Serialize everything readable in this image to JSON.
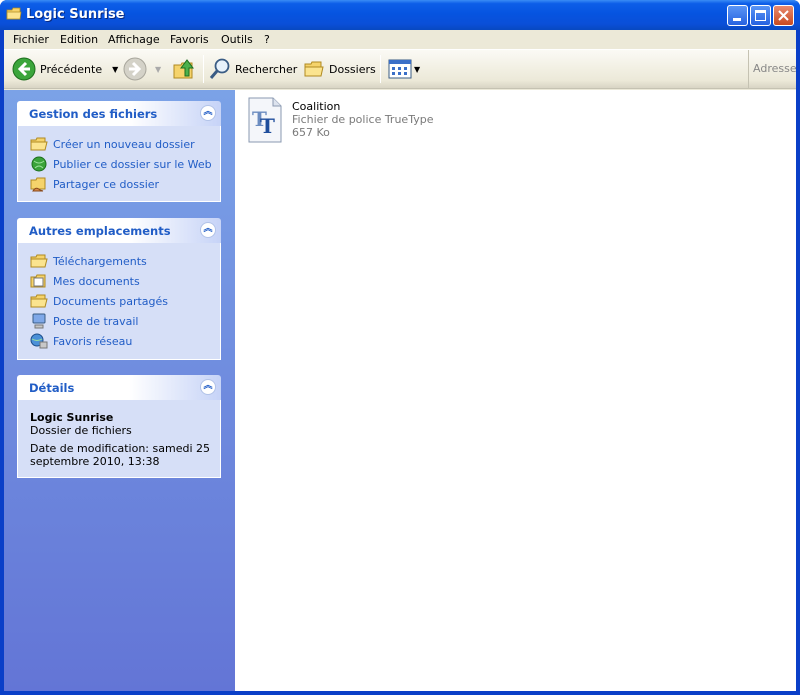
{
  "window": {
    "title": "Logic Sunrise"
  },
  "menu": [
    "Fichier",
    "Edition",
    "Affichage",
    "Favoris",
    "Outils",
    "?"
  ],
  "toolbar": {
    "back_label": "Précédente",
    "search_label": "Rechercher",
    "folders_label": "Dossiers",
    "address_label": "Adresse"
  },
  "panels": {
    "file_tasks": {
      "title": "Gestion des fichiers",
      "items": [
        "Créer un nouveau dossier",
        "Publier ce dossier sur le Web",
        "Partager ce dossier"
      ]
    },
    "other_places": {
      "title": "Autres emplacements",
      "items": [
        "Téléchargements",
        "Mes documents",
        "Documents partagés",
        "Poste de travail",
        "Favoris réseau"
      ]
    },
    "details": {
      "title": "Détails",
      "name": "Logic Sunrise",
      "type": "Dossier de fichiers",
      "modified_1": "Date de modification: samedi 25",
      "modified_2": "septembre 2010, 13:38"
    }
  },
  "files": [
    {
      "name": "Coalition",
      "type": "Fichier de police TrueType",
      "size": "657 Ko",
      "icon": "truetype-font-icon"
    }
  ],
  "colors": {
    "titlebar": "#0654e0",
    "taskpane": "#7ba2e7",
    "link": "#215dc6"
  }
}
